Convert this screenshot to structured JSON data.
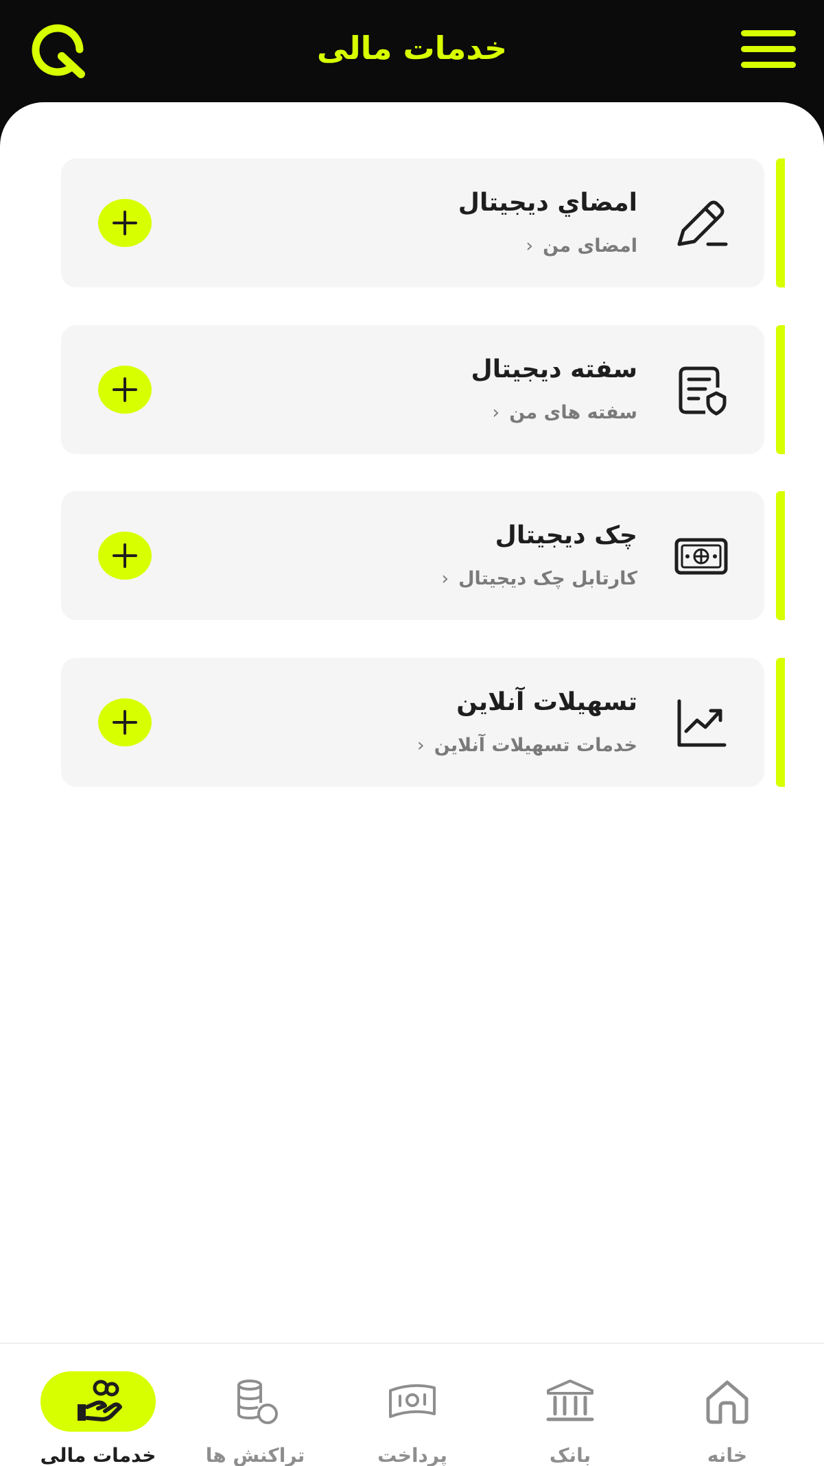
{
  "header": {
    "title": "خدمات مالی",
    "logo_icon": "q-logo-icon",
    "menu_icon": "hamburger-menu-icon"
  },
  "colors": {
    "accent": "#d8ff00",
    "header_bg": "#0b0b0b",
    "card_bg": "#f5f5f5",
    "text_dark": "#1e1e1e",
    "text_muted": "#7a7a7a"
  },
  "services": [
    {
      "title": "امضاي ديجيتال",
      "link": "امضای من",
      "icon": "pen-signature-icon"
    },
    {
      "title": "سفته دیجیتال",
      "link": "سفته های من",
      "icon": "document-shield-icon"
    },
    {
      "title": "چک دیجیتال",
      "link": "کارتابل چک دیجیتال",
      "icon": "cheque-icon"
    },
    {
      "title": "تسهیلات آنلاین",
      "link": "خدمات تسهیلات آنلاین",
      "icon": "chart-trend-icon"
    }
  ],
  "link_chevron": "‹",
  "nav": [
    {
      "label": "خدمات مالی",
      "icon": "hand-coins-icon",
      "active": true
    },
    {
      "label": "تراکنش ها",
      "icon": "coin-stack-icon",
      "active": false
    },
    {
      "label": "پرداخت",
      "icon": "banknote-icon",
      "active": false
    },
    {
      "label": "بانک",
      "icon": "bank-icon",
      "active": false
    },
    {
      "label": "خانه",
      "icon": "home-icon",
      "active": false
    }
  ]
}
